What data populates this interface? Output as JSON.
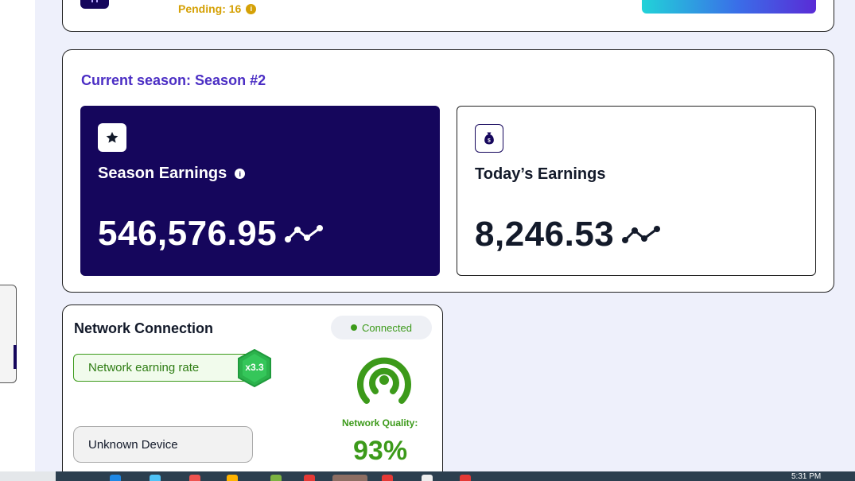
{
  "top": {
    "pending_text": "Pending: 16",
    "pending_info_icon": "info-icon"
  },
  "season": {
    "title": "Current season: Season #2",
    "season_earnings": {
      "icon": "star-icon",
      "label": "Season Earnings",
      "info_icon": "info-icon",
      "value": "546,576.95",
      "currency_icon": "network-token-icon"
    },
    "today_earnings": {
      "icon": "money-bag-icon",
      "label": "Today’s Earnings",
      "value": "8,246.53",
      "currency_icon": "network-token-icon"
    }
  },
  "network": {
    "title": "Network Connection",
    "status": "Connected",
    "rate_label": "Network earning rate",
    "multiplier": "x3.3",
    "device": "Unknown Device",
    "quality_label": "Network Quality:",
    "quality_value": "93%",
    "signal_icon": "signal-icon"
  },
  "taskbar": {
    "clock": "5:31 PM"
  },
  "colors": {
    "navy": "#15065c",
    "purple_title": "#4b2ec4",
    "green": "#3c9a1a",
    "pending_gold": "#d5a106"
  }
}
